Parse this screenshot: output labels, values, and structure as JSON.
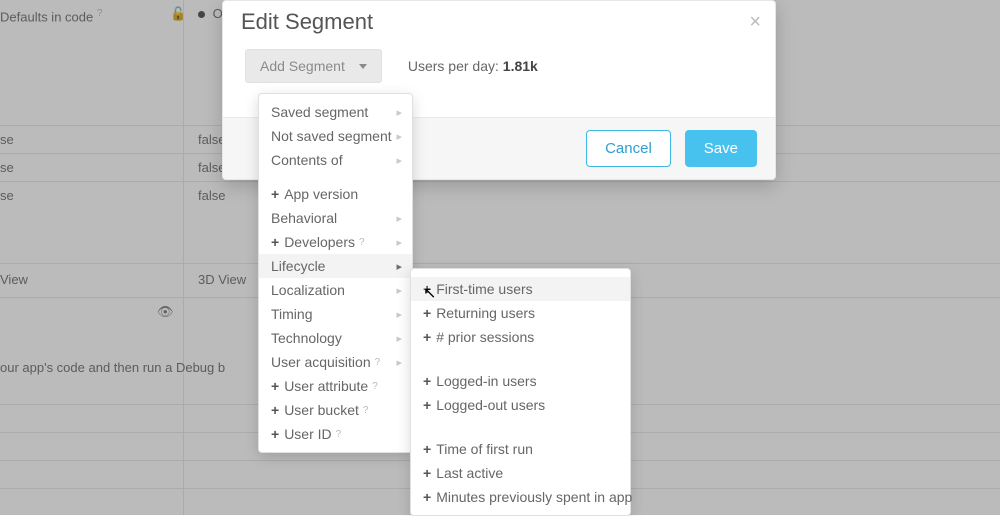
{
  "modal": {
    "title": "Edit Segment",
    "add_segment_label": "Add Segment",
    "users_per_day_prefix": "Users per day: ",
    "users_per_day_value": "1.81k",
    "cancel_label": "Cancel",
    "save_label": "Save"
  },
  "bg": {
    "defaults_in_code": "Defaults in code",
    "ov": "Ov",
    "se": "se",
    "false": "false",
    "view_row_left": "View",
    "view_row_right": "3D View",
    "debug_line": "our app's code and then run a Debug b"
  },
  "primary_menu": [
    {
      "label": "Saved segment",
      "chevron": true
    },
    {
      "label": "Not saved segment",
      "chevron": true
    },
    {
      "label": "Contents of",
      "chevron": true
    },
    {
      "gap": true
    },
    {
      "label": "App version",
      "plus": true
    },
    {
      "label": "Behavioral",
      "chevron": true
    },
    {
      "label": "Developers",
      "plus": true,
      "help": true,
      "chevron": true
    },
    {
      "label": "Lifecycle",
      "chevron": true,
      "active": true
    },
    {
      "label": "Localization",
      "chevron": true
    },
    {
      "label": "Timing",
      "chevron": true
    },
    {
      "label": "Technology",
      "chevron": true
    },
    {
      "label": "User acquisition",
      "help": true,
      "chevron": true
    },
    {
      "label": "User attribute",
      "plus": true,
      "help": true
    },
    {
      "label": "User bucket",
      "plus": true,
      "help": true
    },
    {
      "label": "User ID",
      "plus": true,
      "help": true
    }
  ],
  "secondary_menu": [
    {
      "label": "First-time users",
      "plus": true,
      "hover": true
    },
    {
      "label": "Returning users",
      "plus": true
    },
    {
      "label": "# prior sessions",
      "plus": true
    },
    {
      "group_gap": true
    },
    {
      "label": "Logged-in users",
      "plus": true
    },
    {
      "label": "Logged-out users",
      "plus": true
    },
    {
      "group_gap": true
    },
    {
      "label": "Time of first run",
      "plus": true
    },
    {
      "label": "Last active",
      "plus": true
    },
    {
      "label": "Minutes previously spent in app",
      "plus": true
    }
  ]
}
